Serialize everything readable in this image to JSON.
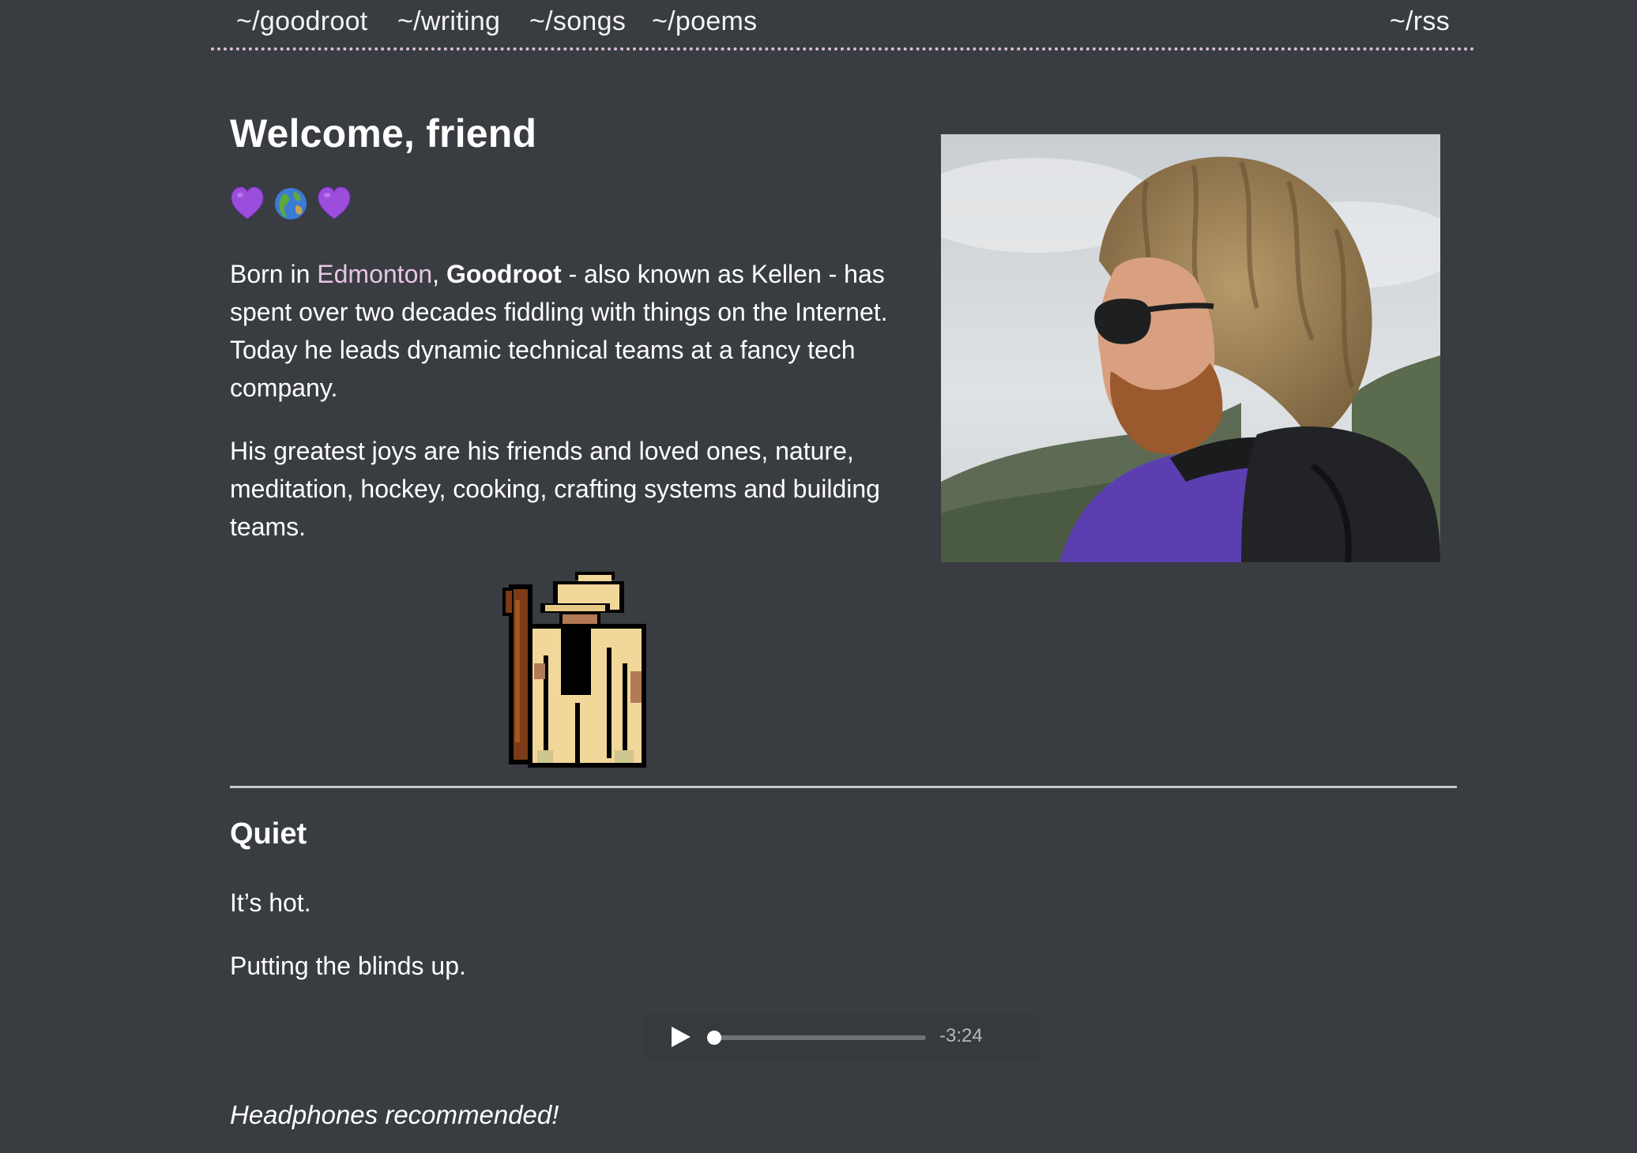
{
  "nav": {
    "items": [
      {
        "label": "~/goodroot"
      },
      {
        "label": "~/writing"
      },
      {
        "label": "~/songs"
      },
      {
        "label": "~/poems"
      }
    ],
    "rss": "~/rss"
  },
  "intro": {
    "title": "Welcome, friend",
    "emoji": [
      "purple-heart-icon",
      "globe-icon",
      "purple-heart-icon"
    ],
    "para1": {
      "prefix": "Born in ",
      "city_link": "Edmonton",
      "comma": ", ",
      "name": "Goodroot",
      "rest": " - also known as Kellen - has spent over two decades fiddling with things on the Internet. Today he leads dynamic technical teams at a fancy tech company."
    },
    "para2": "His greatest joys are his friends and loved ones, nature, meditation, hockey, cooking, crafting systems and building teams.",
    "photo_icon": "profile-photo",
    "sprite_icon": "pixel-wizard"
  },
  "post": {
    "title": "Quiet",
    "line1": "It’s hot.",
    "line2": "Putting the blinds up.",
    "player": {
      "time": "-3:24",
      "progress": 0.0
    },
    "note": "Headphones recommended!"
  },
  "colors": {
    "background": "#393c40",
    "link": "#e6c6e4",
    "nav_border": "#d8bfd8"
  }
}
